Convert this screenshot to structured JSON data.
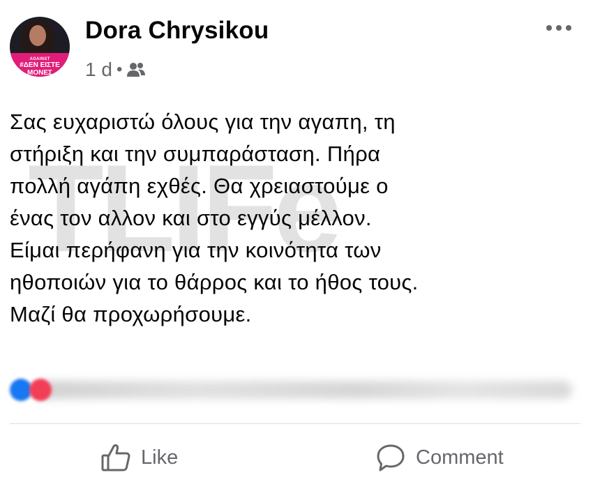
{
  "post": {
    "author": "Dora Chrysikou",
    "time": "1 d",
    "separator": "•",
    "audience_icon": "friends-icon",
    "more_icon": "more-horizontal-icon",
    "avatar": {
      "badge_small": "AGAINST",
      "badge_main": "#ΔΕΝ ΕΙΣΤΕ ΜΟΝΕΣ"
    },
    "text_lines": [
      "Σας ευχαριστώ όλους για την αγαπη, τη",
      "στήριξη και την συμπαράσταση. Πήρα",
      "πολλή αγάπη εχθές. Θα χρειαστούμε ο",
      "ένας τον αλλον και στο εγγύς μέλλον.",
      "Είμαι περήφανη για την κοινότητα των",
      "ηθοποιών για το θάρρος και το ήθος τους.",
      "Μαζί θα προχωρήσουμε."
    ],
    "watermark": "TLIFe"
  },
  "reactions": {
    "icons": [
      "like-reaction-icon",
      "love-reaction-icon"
    ],
    "colors": {
      "like": "#1877f2",
      "love": "#f33e58"
    }
  },
  "actions": {
    "like_label": "Like",
    "comment_label": "Comment"
  },
  "colors": {
    "text": "#050505",
    "secondary": "#65676b",
    "divider": "#dadde1"
  }
}
